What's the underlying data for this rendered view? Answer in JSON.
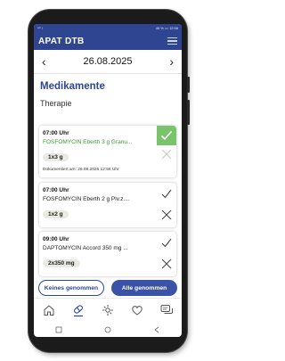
{
  "status_bar": {
    "left": "ᵛᵒˡ ↑",
    "right": "46 % ▭ 12:58"
  },
  "app": {
    "title": "APAT DTB"
  },
  "date_nav": {
    "prev": "‹",
    "date": "26.08.2025",
    "next": "›"
  },
  "section_title": "Medikamente",
  "subsection_title": "Therapie",
  "medications": [
    {
      "time": "07:00 Uhr",
      "name": "FOSFOMYCIN Eberth 3 g Granu...",
      "dose": "1x3 g",
      "documented": "Dokumentiert am: 26.08.2025 12:56 Uhr",
      "status": "taken"
    },
    {
      "time": "07:00 Uhr",
      "name": "FOSFOMYCIN Eberth 2 g Plv.z....",
      "dose": "1x2 g",
      "documented": "",
      "status": "open"
    },
    {
      "time": "09:00 Uhr",
      "name": "DAPTOMYCIN Accord 350 mg ...",
      "dose": "2x350 mg",
      "documented": "",
      "status": "open"
    }
  ],
  "actions": {
    "none_taken": "Keines genommen",
    "all_taken": "Alle genommen"
  },
  "colors": {
    "primary": "#2f4592",
    "taken_green": "#79c36a",
    "taken_text": "#3c9a35"
  },
  "tabs": [
    {
      "icon": "home-icon",
      "active": false
    },
    {
      "icon": "pill-icon",
      "active": true
    },
    {
      "icon": "symptoms-icon",
      "active": false
    },
    {
      "icon": "heart-icon",
      "active": false
    },
    {
      "icon": "chat-icon",
      "active": false
    }
  ]
}
